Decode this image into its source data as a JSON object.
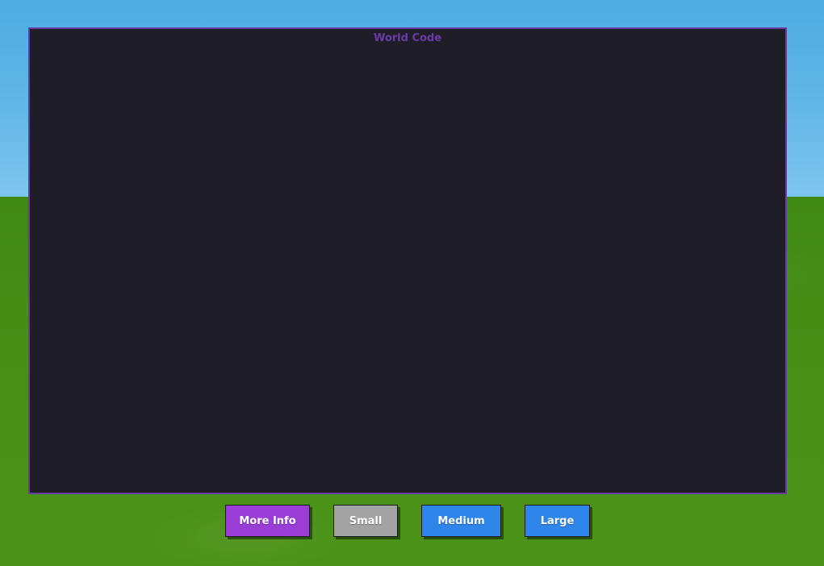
{
  "panel": {
    "title": "World Code"
  },
  "buttons": {
    "more_info": "More Info",
    "small": "Small",
    "medium": "Medium",
    "large": "Large"
  },
  "colors": {
    "sky": "#5ab2e6",
    "grass": "#468f17",
    "panel_bg": "#1f1e28",
    "panel_border": "#6a3aa3",
    "title_text": "#6b3aa9",
    "more_info_button": "#9b3ed8",
    "small_button": "#a3a3a3",
    "medium_button": "#2f86ea",
    "large_button": "#2f86ea"
  }
}
